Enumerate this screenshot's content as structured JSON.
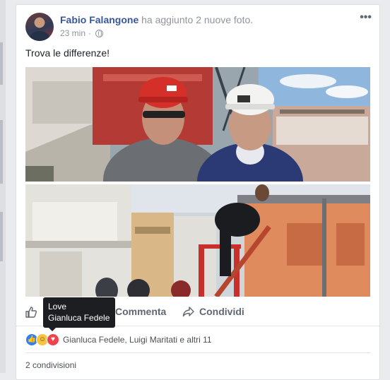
{
  "post": {
    "author": "Fabio Falangone",
    "action_text": "ha aggiunto 2 nuove foto.",
    "time": "23 min",
    "separator": "·",
    "privacy_icon": "globe-icon",
    "more_icon": "•••",
    "text": "Trova le differenze!"
  },
  "actions": {
    "like": "Mi piace",
    "comment": "Commenta",
    "share": "Condividi"
  },
  "reactions": {
    "icons": [
      "like-reaction-icon",
      "haha-reaction-icon",
      "love-reaction-icon"
    ],
    "names": "Gianluca Fedele, Luigi Maritati e altri 11"
  },
  "tooltip": {
    "title": "Love",
    "name": "Gianluca Fedele"
  },
  "shares": "2 condivisioni",
  "colors": {
    "link": "#365899",
    "like": "#2e80f5",
    "haha": "#f7c340",
    "love": "#f0424d"
  }
}
